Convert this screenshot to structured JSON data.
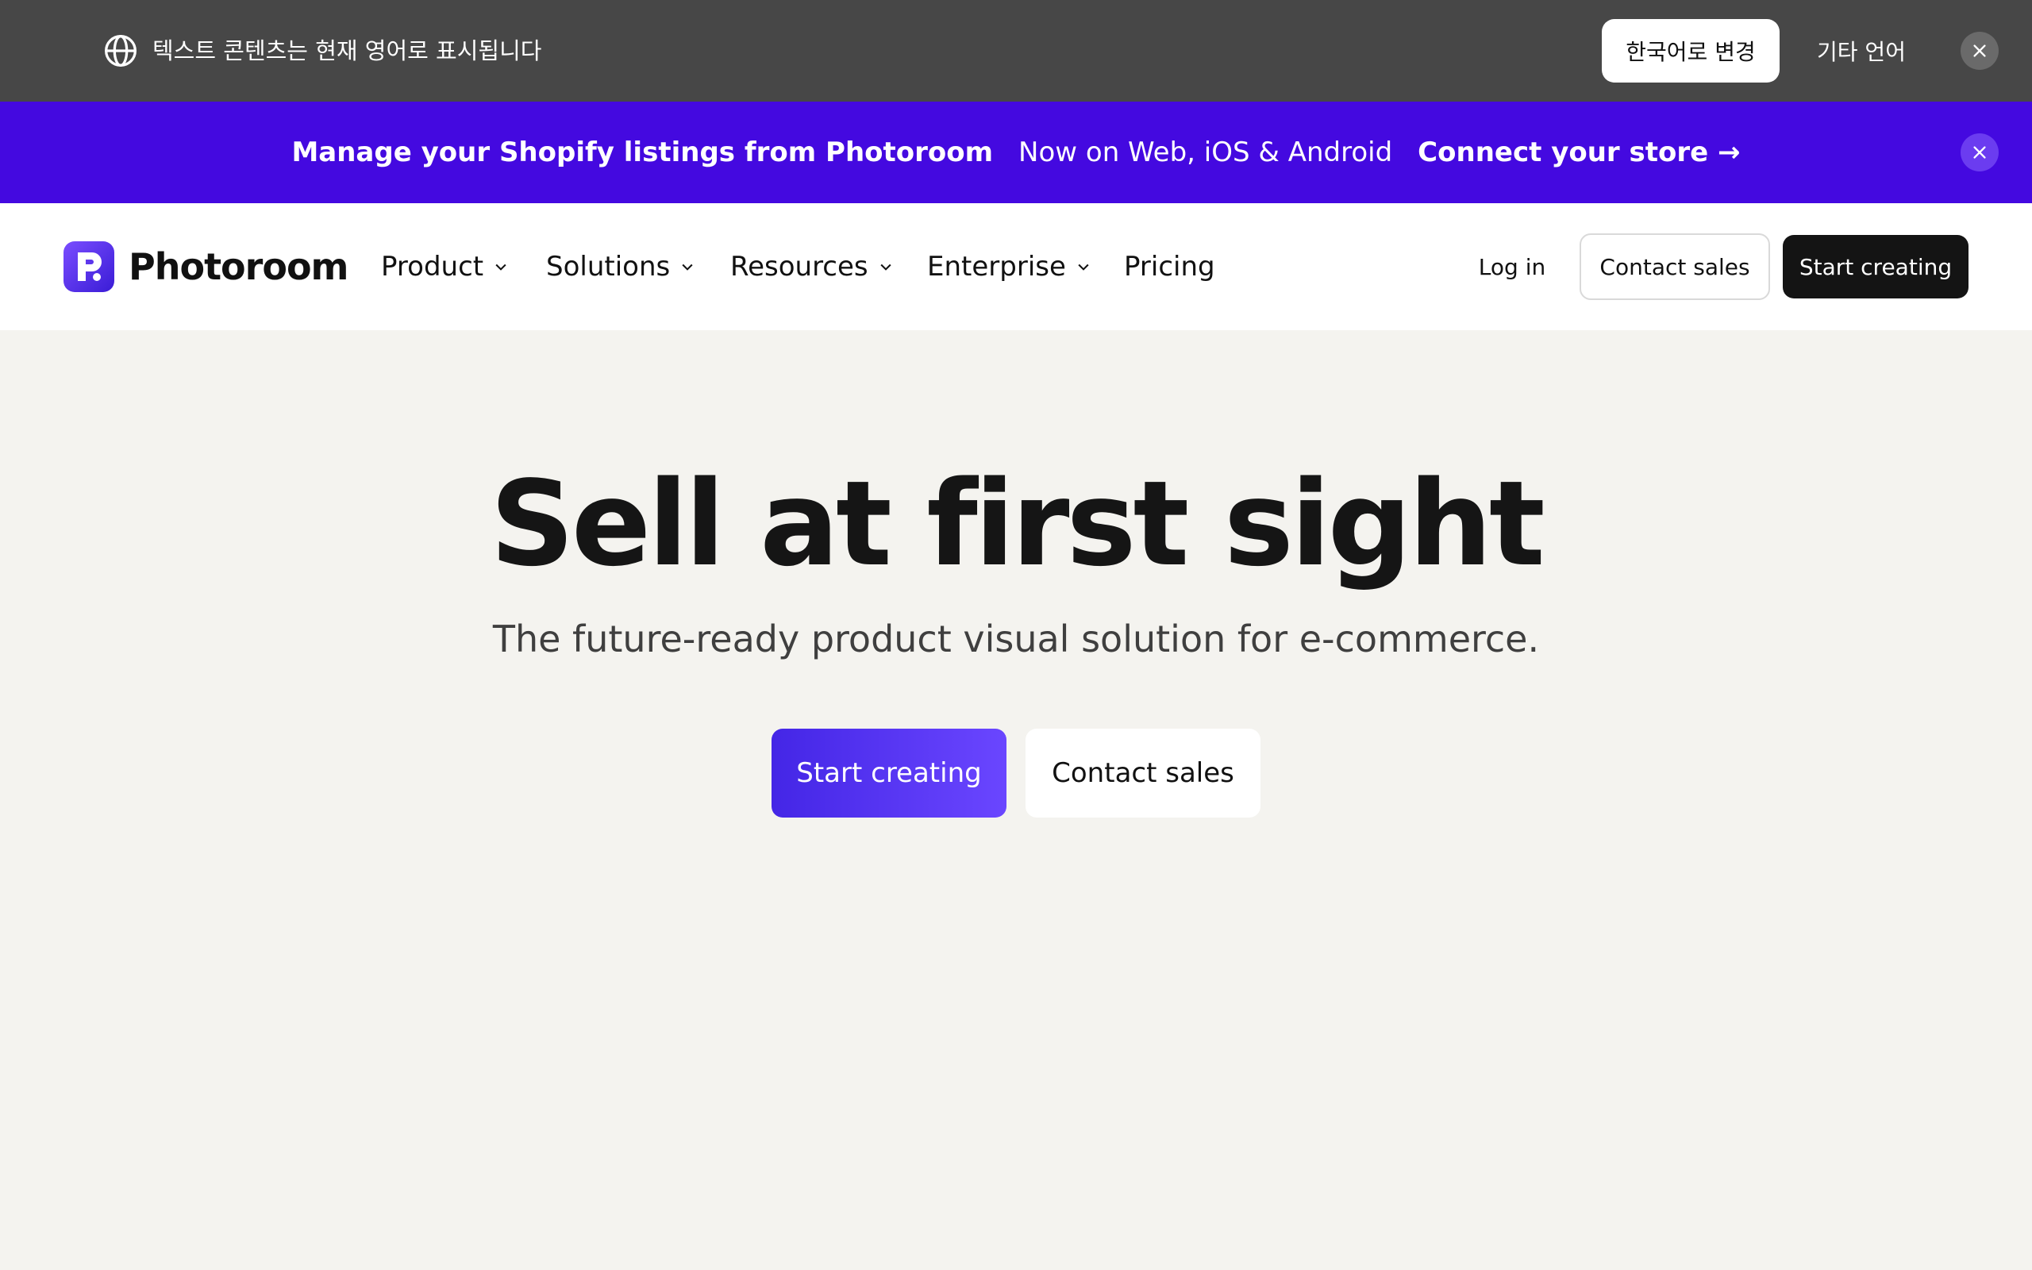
{
  "language_bar": {
    "message": "텍스트 콘텐츠는 현재 영어로 표시됩니다",
    "switch_label": "한국어로 변경",
    "other_label": "기타 언어"
  },
  "promo_bar": {
    "headline": "Manage your Shopify listings from Photoroom",
    "platforms": "Now on Web, iOS & Android",
    "cta": "Connect your store →"
  },
  "nav": {
    "brand": "Photoroom",
    "items": [
      {
        "label": "Product",
        "dropdown": true
      },
      {
        "label": "Solutions",
        "dropdown": true
      },
      {
        "label": "Resources",
        "dropdown": true
      },
      {
        "label": "Enterprise",
        "dropdown": true
      },
      {
        "label": "Pricing",
        "dropdown": false
      }
    ],
    "login": "Log in",
    "contact": "Contact sales",
    "start": "Start creating"
  },
  "hero": {
    "title": "Sell at first sight",
    "subtitle": "The future-ready product visual solution for e-commerce.",
    "primary_cta": "Start creating",
    "secondary_cta": "Contact sales"
  },
  "colors": {
    "language_bar_bg": "#474747",
    "promo_bg": "#4409e0",
    "page_bg": "#f4f3ef",
    "accent": "#4426e6"
  }
}
